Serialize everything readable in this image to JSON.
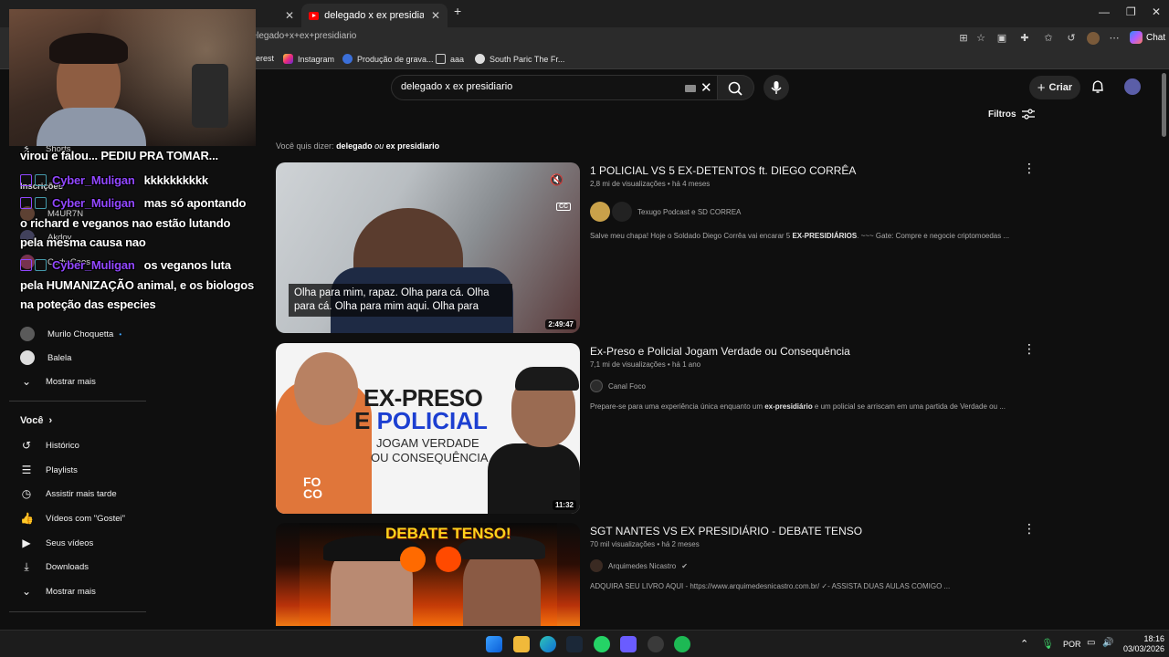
{
  "browser": {
    "active_tab_title": "delegado x ex presidiario - YouTube",
    "url": "delegado+x+ex+presidiario",
    "chat_label": "Chat",
    "bookmarks": [
      {
        "label": "erest"
      },
      {
        "label": "Instagram"
      },
      {
        "label": "Produção de grava..."
      },
      {
        "label": "aaa"
      },
      {
        "label": "South Paric The Fr..."
      }
    ]
  },
  "header": {
    "search_query": "delegado x ex presidiario",
    "create_label": "Criar",
    "filters_label": "Filtros"
  },
  "did_you_mean": {
    "prefix": "Você quis dizer:",
    "part1": "delegado",
    "part2": "ou",
    "part3": "ex presidiario"
  },
  "results": [
    {
      "title": "1 POLICIAL VS 5 EX-DETENTOS ft. DIEGO CORRÊA",
      "meta": "2,8 mi de visualizações • há 4 meses",
      "channel": "Texugo Podcast e SD CORREA",
      "description": "Salve meu chapa! Hoje o Soldado Diego Corrêa vai encarar 5 EX-PRESIDIÁRIOS. ~~~ Gate: Compre e negocie criptomoedas ...",
      "duration": "2:49:47",
      "caption": "Olha para mim, rapaz. Olha para cá. Olha para cá. Olha para mim aqui. Olha para",
      "cc": "CC"
    },
    {
      "title": "Ex-Preso e Policial Jogam Verdade ou Consequência",
      "meta": "7,1 mi de visualizações • há 1 ano",
      "channel": "Canal Foco",
      "description": "Prepare-se para uma experiência única enquanto um ex-presidiário e um policial se arriscam em uma partida de Verdade ou ...",
      "duration": "11:32",
      "thumb_line1": "EX-PRESO",
      "thumb_line2a": "E ",
      "thumb_line2b": "POLICIAL",
      "thumb_line3": "JOGAM VERDADE",
      "thumb_line4": "OU CONSEQUÊNCIA",
      "thumb_logo": "FO CO"
    },
    {
      "title": "SGT NANTES VS EX PRESIDIÁRIO - DEBATE TENSO",
      "meta": "70 mil visualizações • há 2 meses",
      "channel": "Arquimedes Nicastro",
      "description": "ADQUIRA SEU LIVRO AQUI - https://www.arquimedesnicastro.com.br/ ✓- ASSISTA DUAS AULAS COMIGO ...",
      "thumb_banner": "DEBATE TENSO!"
    }
  ],
  "sidebar": {
    "shorts": "Shorts",
    "subscriptions": "Inscrições",
    "channels": [
      "M4UR7N",
      "Akdov",
      "Cady Caos",
      "Murilo Choquetta",
      "Balela"
    ],
    "show_more": "Mostrar mais",
    "you_section": "Você",
    "you_items": [
      "Histórico",
      "Playlists",
      "Assistir mais tarde",
      "Vídeos com \"Gostei\"",
      "Seus vídeos",
      "Downloads",
      "Mostrar mais"
    ]
  },
  "overlay_chat": [
    {
      "text": "virou e falou... PEDIU PRA TOMAR..."
    },
    {
      "user": "Cyber_Muligan",
      "text": "kkkkkkkkkk"
    },
    {
      "user": "Cyber_Muligan",
      "text": "mas só apontando"
    },
    {
      "text": "o richard e veganos nao estão lutando"
    },
    {
      "text": "pela mesma causa nao"
    },
    {
      "user": "Cyber_Muligan",
      "text": "os veganos luta"
    },
    {
      "text": "pela HUMANIZAÇÃO animal, e os biologos"
    },
    {
      "text": "na poteção das especies"
    }
  ],
  "taskbar": {
    "lang": "POR",
    "time": "18:16",
    "date": "03/03/2026"
  },
  "colors": {
    "bg": "#0f0f0f",
    "accent_red": "#ff0000",
    "twitch_purple": "#9147ff"
  }
}
